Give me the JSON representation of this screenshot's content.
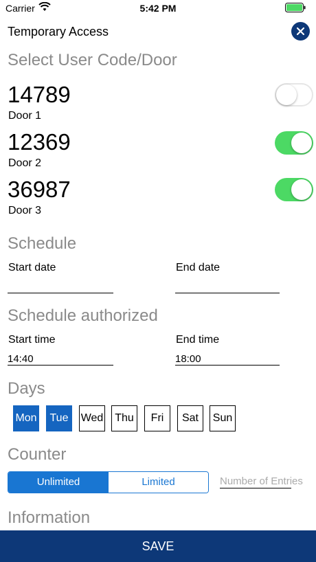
{
  "status_bar": {
    "carrier": "Carrier",
    "time": "5:42 PM"
  },
  "header": {
    "title": "Temporary Access"
  },
  "sections": {
    "select": "Select User Code/Door",
    "schedule": "Schedule",
    "schedule_authorized": "Schedule authorized",
    "days": "Days",
    "counter": "Counter",
    "information": "Information"
  },
  "doors": [
    {
      "code": "14789",
      "name": "Door 1",
      "enabled": false
    },
    {
      "code": "12369",
      "name": "Door 2",
      "enabled": true
    },
    {
      "code": "36987",
      "name": "Door 3",
      "enabled": true
    }
  ],
  "schedule": {
    "start_date_label": "Start date",
    "start_date_value": "",
    "end_date_label": "End date",
    "end_date_value": ""
  },
  "schedule_authorized": {
    "start_time_label": "Start time",
    "start_time_value": "14:40",
    "end_time_label": "End time",
    "end_time_value": "18:00"
  },
  "days": [
    {
      "label": "Mon",
      "selected": true
    },
    {
      "label": "Tue",
      "selected": true
    },
    {
      "label": "Wed",
      "selected": false
    },
    {
      "label": "Thu",
      "selected": false
    },
    {
      "label": "Fri",
      "selected": false
    },
    {
      "label": "Sat",
      "selected": false
    },
    {
      "label": "Sun",
      "selected": false
    }
  ],
  "counter": {
    "options": [
      "Unlimited",
      "Limited"
    ],
    "selected": "Unlimited",
    "entries_placeholder": "Number of Entries"
  },
  "save_label": "SAVE",
  "colors": {
    "brand": "#0d3878",
    "accent": "#1976d2",
    "day_selected": "#1565c0",
    "toggle_on": "#4cd964",
    "section_heading": "#8a8a8a"
  },
  "icons": {
    "wifi": "wifi-icon",
    "battery": "battery-icon",
    "close": "close-icon"
  }
}
